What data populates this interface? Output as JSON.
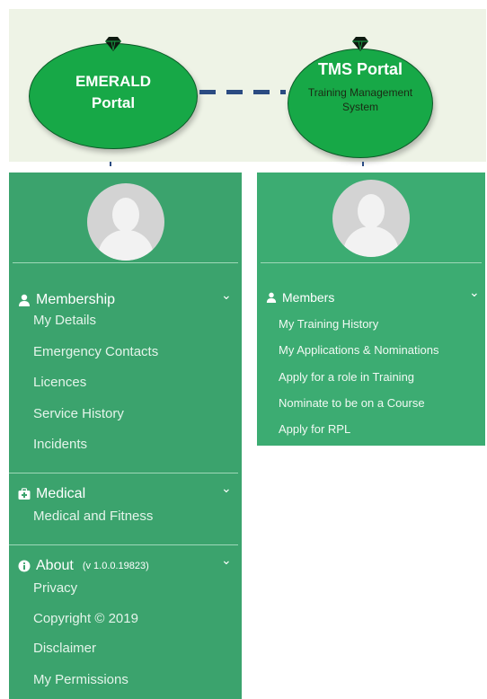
{
  "diagram": {
    "emerald_title": "EMERALD Portal",
    "tms_title": "TMS Portal",
    "tms_subtitle": "Training Management System"
  },
  "left_menu": {
    "membership": {
      "label": "Membership",
      "items": [
        "My Details",
        "Emergency Contacts",
        "Licences",
        "Service History",
        "Incidents"
      ]
    },
    "medical": {
      "label": "Medical",
      "items": [
        "Medical and Fitness"
      ]
    },
    "about": {
      "label": "About",
      "version": "(v 1.0.0.19823)",
      "items": [
        "Privacy",
        "Copyright © 2019",
        "Disclaimer",
        "My Permissions"
      ]
    }
  },
  "right_menu": {
    "members": {
      "label": "Members",
      "items": [
        "My Training History",
        "My Applications & Nominations",
        "Apply for a role in Training",
        "Nominate to be on a Course",
        "Apply for RPL"
      ]
    }
  },
  "colors": {
    "portal_green": "#17a847",
    "menu_green": "#3ba36d",
    "connector": "#2b4b82"
  },
  "icons": {
    "portal": "diamond-icon",
    "membership": "user-icon",
    "medical": "medical-kit-icon",
    "about": "info-icon",
    "collapse": "chevron-down-icon"
  }
}
